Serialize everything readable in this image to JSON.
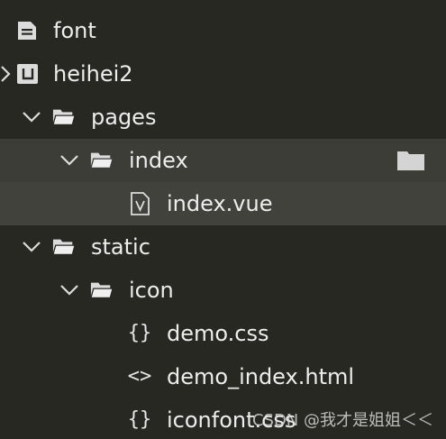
{
  "tree": {
    "items": [
      {
        "label": "font",
        "icon": "document-icon",
        "expanded": null
      },
      {
        "label": "heihei2",
        "icon": "project-icon",
        "expanded": false
      },
      {
        "label": "pages",
        "icon": "folder-icon",
        "expanded": true
      },
      {
        "label": "index",
        "icon": "folder-icon",
        "expanded": true
      },
      {
        "label": "index.vue",
        "icon": "vue-file-icon",
        "expanded": null
      },
      {
        "label": "static",
        "icon": "folder-icon",
        "expanded": true
      },
      {
        "label": "icon",
        "icon": "folder-icon",
        "expanded": true
      },
      {
        "label": "demo.css",
        "icon": "css-braces-icon",
        "glyph": "{}"
      },
      {
        "label": "demo_index.html",
        "icon": "html-tag-icon",
        "glyph": "<>"
      },
      {
        "label": "iconfont.css",
        "icon": "css-braces-icon",
        "glyph": "{}"
      }
    ]
  },
  "watermark": "CSDN @我才是姐姐＜＜",
  "colors": {
    "background": "#272822",
    "hover_row": "#3c3d37",
    "selected_row": "#41423b",
    "text": "#ededed",
    "icon": "#dcdcdc"
  }
}
